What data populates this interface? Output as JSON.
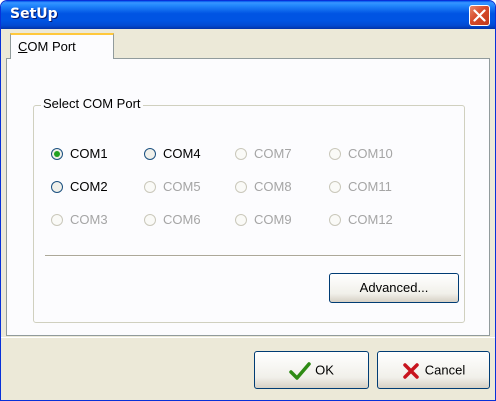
{
  "window": {
    "title": "SetUp"
  },
  "tabs": [
    {
      "label_u": "C",
      "label_rest": "OM Port"
    }
  ],
  "group": {
    "label": "Select COM Port",
    "ports": [
      {
        "label": "COM1",
        "checked": true,
        "enabled": true
      },
      {
        "label": "COM2",
        "checked": false,
        "enabled": true
      },
      {
        "label": "COM3",
        "checked": false,
        "enabled": false
      },
      {
        "label": "COM4",
        "checked": false,
        "enabled": true
      },
      {
        "label": "COM5",
        "checked": false,
        "enabled": false
      },
      {
        "label": "COM6",
        "checked": false,
        "enabled": false
      },
      {
        "label": "COM7",
        "checked": false,
        "enabled": false
      },
      {
        "label": "COM8",
        "checked": false,
        "enabled": false
      },
      {
        "label": "COM9",
        "checked": false,
        "enabled": false
      },
      {
        "label": "COM10",
        "checked": false,
        "enabled": false
      },
      {
        "label": "COM11",
        "checked": false,
        "enabled": false
      },
      {
        "label": "COM12",
        "checked": false,
        "enabled": false
      }
    ],
    "advanced_label": "Advanced..."
  },
  "footer": {
    "ok_label": "OK",
    "cancel_label": "Cancel"
  },
  "colors": {
    "title_bar": "#0054e3",
    "ok_check": "#2e8b14",
    "cancel_x": "#c8141e"
  }
}
